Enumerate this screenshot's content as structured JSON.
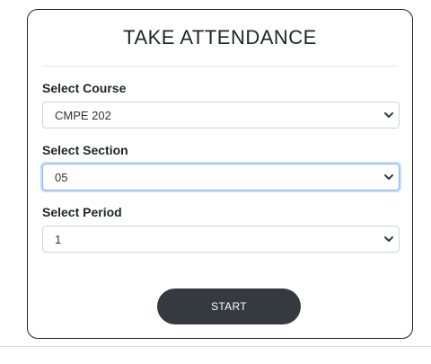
{
  "form": {
    "title": "TAKE ATTENDANCE",
    "course": {
      "label": "Select Course",
      "value": "CMPE 202"
    },
    "section": {
      "label": "Select Section",
      "value": "05"
    },
    "period": {
      "label": "Select Period",
      "value": "1"
    },
    "start_label": "START"
  },
  "colors": {
    "button_bg": "#343a40",
    "focus_border": "#86b7fe"
  },
  "icons": {
    "dropdown": "chevron-down-icon"
  }
}
